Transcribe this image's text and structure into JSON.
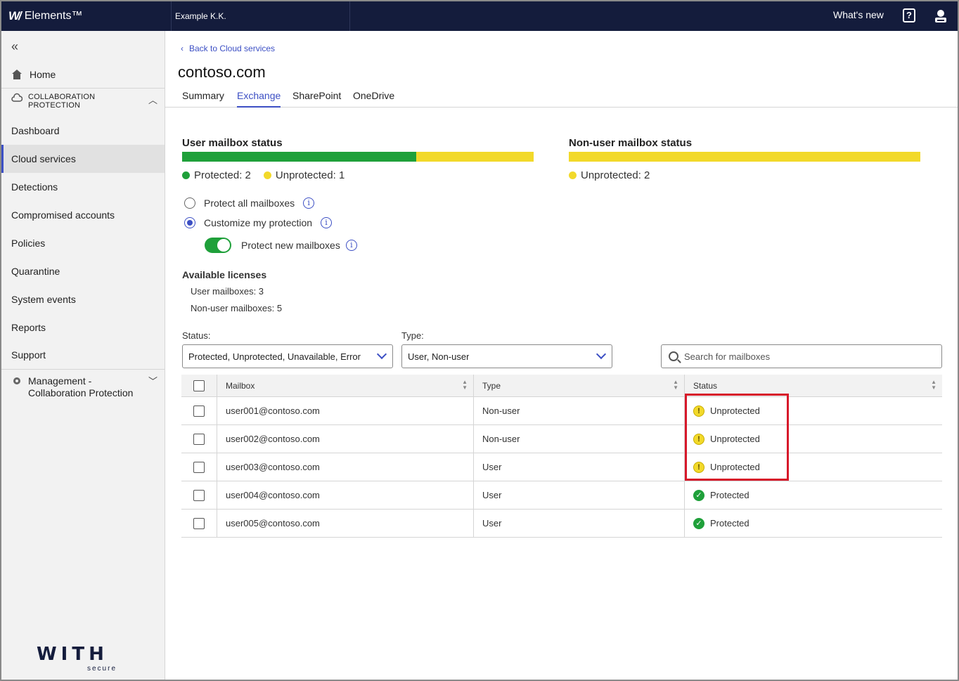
{
  "topbar": {
    "logo_mark": "W/",
    "brand": "Elements™",
    "org": "Example K.K.",
    "whats_new": "What's new",
    "help_glyph": "?"
  },
  "sidebar": {
    "home": "Home",
    "group_label": "COLLABORATION PROTECTION",
    "items": [
      {
        "label": "Dashboard"
      },
      {
        "label": "Cloud services"
      },
      {
        "label": "Detections"
      },
      {
        "label": "Compromised accounts"
      },
      {
        "label": "Policies"
      },
      {
        "label": "Quarantine"
      },
      {
        "label": "System events"
      },
      {
        "label": "Reports"
      },
      {
        "label": "Support"
      }
    ],
    "management": "Management - Collaboration Protection",
    "footer_logo_big": "WITH",
    "footer_logo_small": "secure"
  },
  "page": {
    "back_link": "Back to Cloud services",
    "title": "contoso.com",
    "tabs": [
      "Summary",
      "Exchange",
      "SharePoint",
      "OneDrive"
    ],
    "active_tab": "Exchange"
  },
  "user_status": {
    "title": "User mailbox status",
    "protected_label": "Protected: 2",
    "unprotected_label": "Unprotected: 1",
    "protected": 2,
    "unprotected": 1
  },
  "nonuser_status": {
    "title": "Non-user mailbox status",
    "unprotected_label": "Unprotected: 2",
    "unprotected": 2
  },
  "protection": {
    "option_all": "Protect all mailboxes",
    "option_custom": "Customize my protection",
    "selected": "custom",
    "toggle_label": "Protect new mailboxes",
    "toggle_on": true
  },
  "licenses": {
    "title": "Available licenses",
    "user": "User mailboxes: 3",
    "nonuser": "Non-user mailboxes: 5"
  },
  "filters": {
    "status_label": "Status:",
    "status_value": "Protected, Unprotected, Unavailable, Error",
    "type_label": "Type:",
    "type_value": "User, Non-user",
    "search_placeholder": "Search for mailboxes"
  },
  "table": {
    "headers": {
      "mailbox": "Mailbox",
      "type": "Type",
      "status": "Status"
    },
    "rows": [
      {
        "mailbox": "user001@contoso.com",
        "type": "Non-user",
        "status": "Unprotected"
      },
      {
        "mailbox": "user002@contoso.com",
        "type": "Non-user",
        "status": "Unprotected"
      },
      {
        "mailbox": "user003@contoso.com",
        "type": "User",
        "status": "Unprotected"
      },
      {
        "mailbox": "user004@contoso.com",
        "type": "User",
        "status": "Protected"
      },
      {
        "mailbox": "user005@contoso.com",
        "type": "User",
        "status": "Protected"
      }
    ]
  },
  "colors": {
    "topbar": "#141c3c",
    "accent": "#3c4fc4",
    "protected": "#1fa03a",
    "unprotected": "#f2d92a",
    "highlight": "#d7182a"
  }
}
